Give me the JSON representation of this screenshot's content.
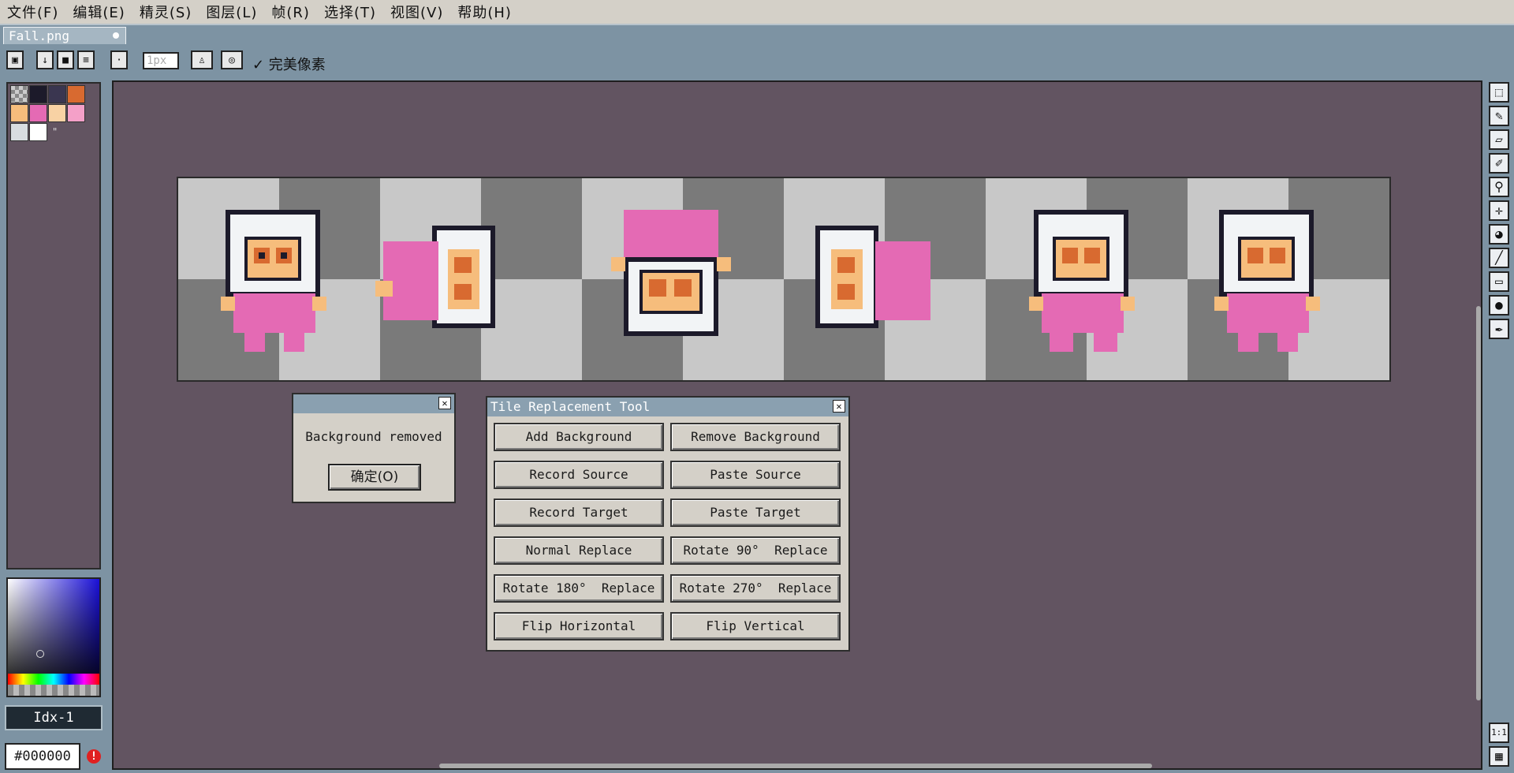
{
  "menu": [
    "文件(F)",
    "编辑(E)",
    "精灵(S)",
    "图层(L)",
    "帧(R)",
    "选择(T)",
    "视图(V)",
    "帮助(H)"
  ],
  "tab": {
    "title": "Fall.png"
  },
  "toolbar": {
    "pixel_size": "1px",
    "pixel_perfect_label": "✓ 完美像素"
  },
  "palette": {
    "colors": [
      "#a0a0a0",
      "#1c1a2a",
      "#3a3650",
      "#d86a30",
      "#f6bd7c",
      "#e46ab4",
      "#f8d2a4",
      "#f4a0c8",
      "#d8dde0",
      "#ffffff"
    ],
    "more_label": "\""
  },
  "color_panel": {
    "index_label": "Idx-1",
    "hex_value": "#000000"
  },
  "message_dialog": {
    "message": "Background removed",
    "ok_label": "确定(O)"
  },
  "tile_tool": {
    "title": "Tile Replacement Tool",
    "buttons": [
      "Add Background",
      "Remove Background",
      "Record Source",
      "Paste Source",
      "Record Target",
      "Paste Target",
      "Normal Replace",
      "Rotate 90°  Replace",
      "Rotate 180°  Replace",
      "Rotate 270°  Replace",
      "Flip Horizontal",
      "Flip Vertical"
    ]
  },
  "right_tools": [
    "marquee-icon",
    "pencil-icon",
    "eraser-icon",
    "eyedropper-icon",
    "zoom-icon",
    "move-icon",
    "fill-icon",
    "line-icon",
    "rectangle-icon",
    "ellipse-icon",
    "brush-icon"
  ],
  "zoom_label": "1:1",
  "colors": {
    "canvas_bg": "#625461",
    "chrome": "#7d93a3",
    "sprite_pink": "#e46ab4",
    "sprite_face": "#f6bd7c"
  }
}
